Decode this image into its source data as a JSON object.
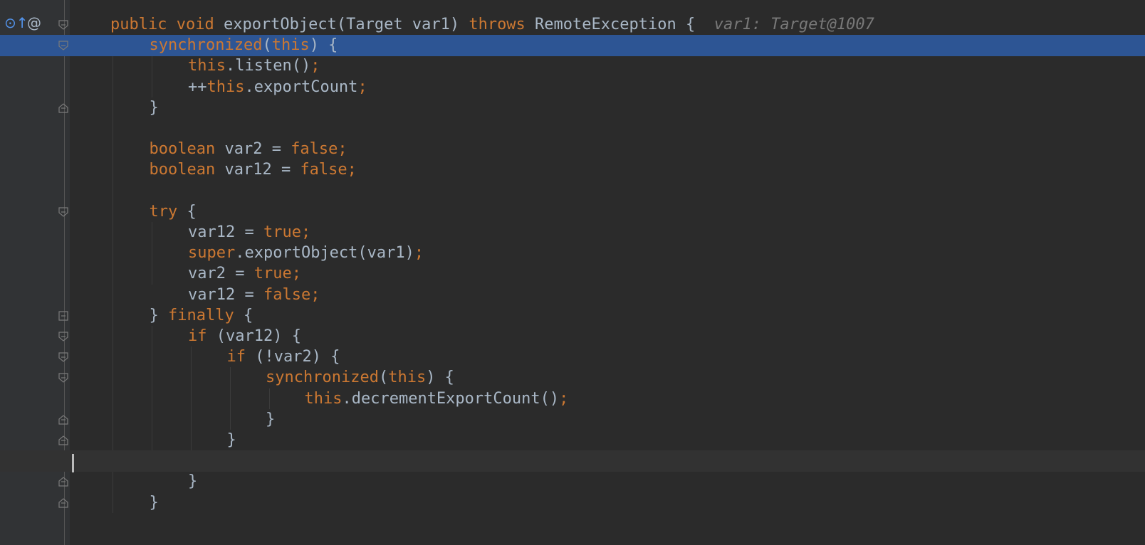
{
  "editor": {
    "language": "java",
    "gutter_icons": [
      {
        "name": "overrides-method-icon",
        "glyph": "⊙↑",
        "color": "#5394ec"
      },
      {
        "name": "annotation-icon",
        "glyph": "@",
        "color": "#a9b7c6"
      }
    ],
    "lines": [
      {
        "indent": 1,
        "tokens": [
          {
            "t": "public ",
            "c": "kw"
          },
          {
            "t": "void ",
            "c": "kw"
          },
          {
            "t": "exportObject(Target var1) ",
            "c": "id"
          },
          {
            "t": "throws ",
            "c": "kw"
          },
          {
            "t": "RemoteException {  ",
            "c": "id"
          },
          {
            "t": "var1: Target@1007",
            "c": "hint"
          }
        ],
        "fold": "open"
      },
      {
        "indent": 2,
        "tokens": [
          {
            "t": "synchronized",
            "c": "kw"
          },
          {
            "t": "(",
            "c": "id"
          },
          {
            "t": "this",
            "c": "kw"
          },
          {
            "t": ") {",
            "c": "id"
          }
        ],
        "fold": "open",
        "exec": true
      },
      {
        "indent": 3,
        "tokens": [
          {
            "t": "this",
            "c": "kw"
          },
          {
            "t": ".listen()",
            "c": "id"
          },
          {
            "t": ";",
            "c": "kw"
          }
        ]
      },
      {
        "indent": 3,
        "tokens": [
          {
            "t": "++",
            "c": "id"
          },
          {
            "t": "this",
            "c": "kw"
          },
          {
            "t": ".exportCount",
            "c": "id"
          },
          {
            "t": ";",
            "c": "kw"
          }
        ]
      },
      {
        "indent": 2,
        "tokens": [
          {
            "t": "}",
            "c": "id"
          }
        ],
        "fold": "close"
      },
      {
        "indent": 0,
        "tokens": []
      },
      {
        "indent": 2,
        "tokens": [
          {
            "t": "boolean ",
            "c": "kw"
          },
          {
            "t": "var2 = ",
            "c": "id"
          },
          {
            "t": "false",
            "c": "kw"
          },
          {
            "t": ";",
            "c": "kw"
          }
        ]
      },
      {
        "indent": 2,
        "tokens": [
          {
            "t": "boolean ",
            "c": "kw"
          },
          {
            "t": "var12 = ",
            "c": "id"
          },
          {
            "t": "false",
            "c": "kw"
          },
          {
            "t": ";",
            "c": "kw"
          }
        ]
      },
      {
        "indent": 0,
        "tokens": []
      },
      {
        "indent": 2,
        "tokens": [
          {
            "t": "try ",
            "c": "kw"
          },
          {
            "t": "{",
            "c": "id"
          }
        ],
        "fold": "open"
      },
      {
        "indent": 3,
        "tokens": [
          {
            "t": "var12 = ",
            "c": "id"
          },
          {
            "t": "true",
            "c": "kw"
          },
          {
            "t": ";",
            "c": "kw"
          }
        ]
      },
      {
        "indent": 3,
        "tokens": [
          {
            "t": "super",
            "c": "kw"
          },
          {
            "t": ".exportObject(var1)",
            "c": "id"
          },
          {
            "t": ";",
            "c": "kw"
          }
        ]
      },
      {
        "indent": 3,
        "tokens": [
          {
            "t": "var2 = ",
            "c": "id"
          },
          {
            "t": "true",
            "c": "kw"
          },
          {
            "t": ";",
            "c": "kw"
          }
        ]
      },
      {
        "indent": 3,
        "tokens": [
          {
            "t": "var12 = ",
            "c": "id"
          },
          {
            "t": "false",
            "c": "kw"
          },
          {
            "t": ";",
            "c": "kw"
          }
        ]
      },
      {
        "indent": 2,
        "tokens": [
          {
            "t": "} ",
            "c": "id"
          },
          {
            "t": "finally ",
            "c": "kw"
          },
          {
            "t": "{",
            "c": "id"
          }
        ],
        "fold": "both"
      },
      {
        "indent": 3,
        "tokens": [
          {
            "t": "if ",
            "c": "kw"
          },
          {
            "t": "(var12) {",
            "c": "id"
          }
        ],
        "fold": "open"
      },
      {
        "indent": 4,
        "tokens": [
          {
            "t": "if ",
            "c": "kw"
          },
          {
            "t": "(!var2) {",
            "c": "id"
          }
        ],
        "fold": "open"
      },
      {
        "indent": 5,
        "tokens": [
          {
            "t": "synchronized",
            "c": "kw"
          },
          {
            "t": "(",
            "c": "id"
          },
          {
            "t": "this",
            "c": "kw"
          },
          {
            "t": ") {",
            "c": "id"
          }
        ],
        "fold": "open"
      },
      {
        "indent": 6,
        "tokens": [
          {
            "t": "this",
            "c": "kw"
          },
          {
            "t": ".decrementExportCount()",
            "c": "id"
          },
          {
            "t": ";",
            "c": "kw"
          }
        ]
      },
      {
        "indent": 5,
        "tokens": [
          {
            "t": "}",
            "c": "id"
          }
        ],
        "fold": "close"
      },
      {
        "indent": 4,
        "tokens": [
          {
            "t": "}",
            "c": "id"
          }
        ],
        "fold": "close"
      },
      {
        "indent": 0,
        "tokens": [],
        "caret": true
      },
      {
        "indent": 3,
        "tokens": [
          {
            "t": "}",
            "c": "id"
          }
        ],
        "fold": "close"
      },
      {
        "indent": 2,
        "tokens": [
          {
            "t": "}",
            "c": "id"
          }
        ],
        "fold": "close"
      }
    ]
  }
}
